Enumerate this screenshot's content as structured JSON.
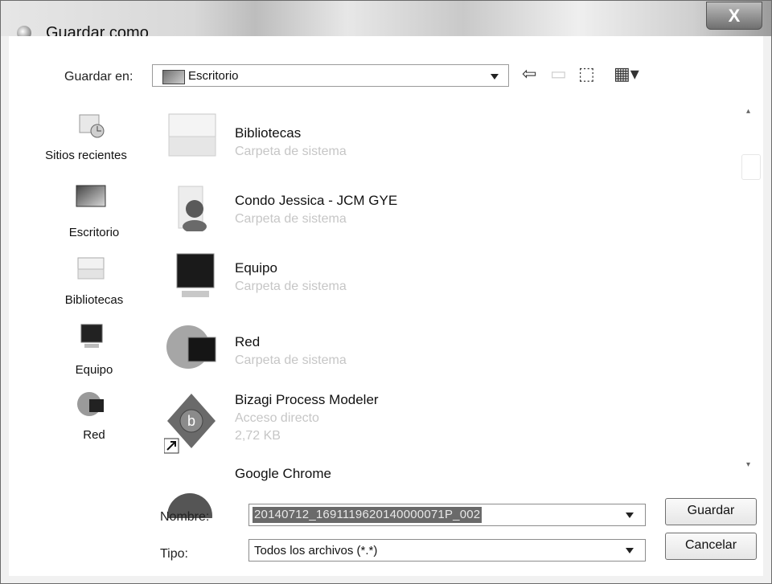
{
  "window": {
    "title": "Guardar como",
    "close_label": "X"
  },
  "toolbar": {
    "save_in_label": "Guardar en:",
    "location_value": "Escritorio",
    "back_icon": "back-arrow-icon",
    "up_icon": "up-folder-icon",
    "new_folder_icon": "new-folder-icon",
    "views_icon": "views-menu-icon"
  },
  "places": [
    {
      "label": "Sitios recientes",
      "icon": "recent-places-icon"
    },
    {
      "label": "Escritorio",
      "icon": "desktop-icon"
    },
    {
      "label": "Bibliotecas",
      "icon": "libraries-icon"
    },
    {
      "label": "Equipo",
      "icon": "computer-icon"
    },
    {
      "label": "Red",
      "icon": "network-icon"
    }
  ],
  "files": [
    {
      "name": "Bibliotecas",
      "details": [
        "Carpeta de sistema"
      ],
      "icon": "libraries-icon"
    },
    {
      "name": "Condo Jessica - JCM GYE",
      "details": [
        "Carpeta de sistema"
      ],
      "icon": "user-folder-icon"
    },
    {
      "name": "Equipo",
      "details": [
        "Carpeta de sistema"
      ],
      "icon": "computer-icon"
    },
    {
      "name": "Red",
      "details": [
        "Carpeta de sistema"
      ],
      "icon": "network-icon"
    },
    {
      "name": "Bizagi Process Modeler",
      "details": [
        "Acceso directo",
        "2,72 KB"
      ],
      "icon": "bizagi-shortcut-icon"
    },
    {
      "name": "Google Chrome",
      "details": [],
      "icon": "chrome-icon"
    }
  ],
  "form": {
    "name_label": "Nombre:",
    "name_value": "20140712_1691119620140000071P_002",
    "type_label": "Tipo:",
    "type_value": "Todos los archivos (*.*)",
    "save_button": "Guardar",
    "cancel_button": "Cancelar"
  }
}
